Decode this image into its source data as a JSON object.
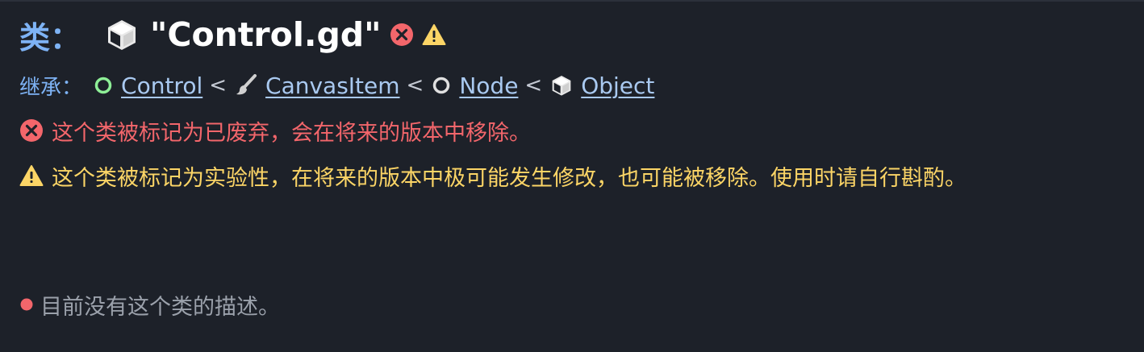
{
  "header": {
    "label": "类",
    "colon": "：",
    "title": "\"Control.gd\""
  },
  "inheritance": {
    "label": "继承：",
    "separator": "<",
    "chain": [
      {
        "name": "Control",
        "icon": "control-circle-icon"
      },
      {
        "name": "CanvasItem",
        "icon": "brush-icon"
      },
      {
        "name": "Node",
        "icon": "node-circle-icon"
      },
      {
        "name": "Object",
        "icon": "cube-icon"
      }
    ]
  },
  "notices": {
    "deprecated": "这个类被标记为已废弃，会在将来的版本中移除。",
    "experimental": "这个类被标记为实验性，在将来的版本中极可能发生修改，也可能被移除。使用时请自行斟酌。"
  },
  "description": {
    "empty_text": "目前没有这个类的描述。"
  },
  "colors": {
    "background": "#1d2129",
    "title_accent": "#7eb3f5",
    "link": "#a9c9f0",
    "error": "#f3666b",
    "warning": "#fcd566",
    "control_green": "#8eef97",
    "muted_text": "#9ba1ab"
  }
}
